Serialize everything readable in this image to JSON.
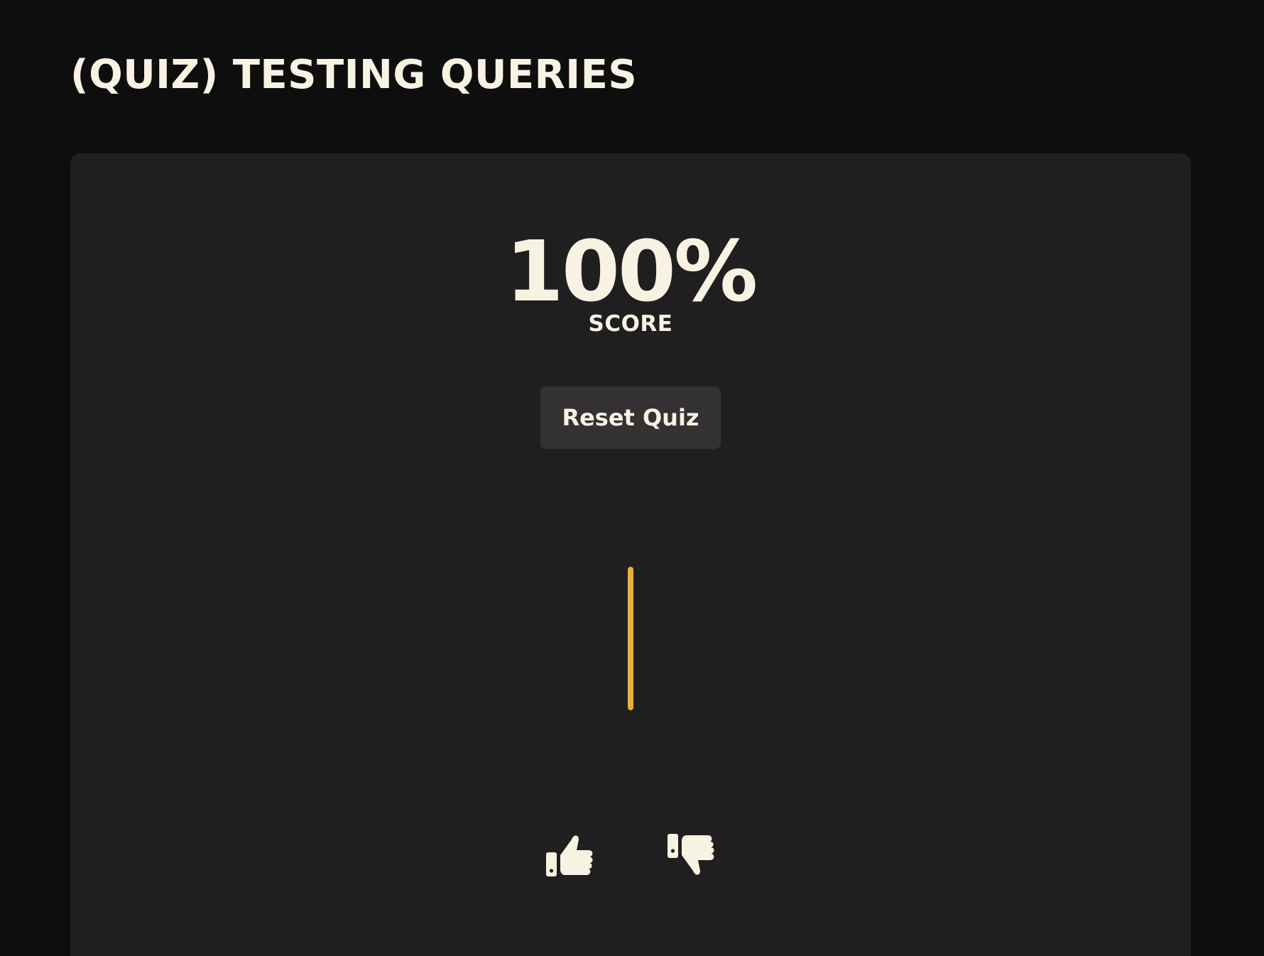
{
  "header": {
    "title": "(QUIZ) TESTING QUERIES"
  },
  "quiz": {
    "score_value": "100%",
    "score_label": "SCORE",
    "reset_label": "Reset Quiz"
  },
  "colors": {
    "background": "#0f0e0f",
    "card": "#201f20",
    "button": "#343132",
    "text": "#f8f2e3",
    "accent": "#e8b03f"
  },
  "icons": {
    "vote_up": "thumbs-up-icon",
    "vote_down": "thumbs-down-icon"
  }
}
